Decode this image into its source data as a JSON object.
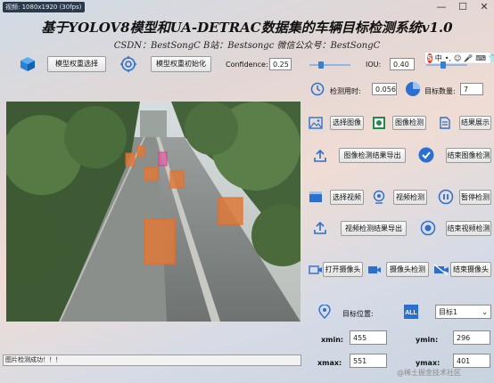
{
  "window": {
    "title": "视频: 1080x1920 (30fps)",
    "minimize": "—",
    "maximize": "☐",
    "close": "✕"
  },
  "header": {
    "title": "基于YOLOV8模型和UA-DETRAC数据集的车辆目标检测系统v1.0",
    "subtitle": "CSDN：BestSongC   B站：Bestsongc   微信公众号：BestSongC"
  },
  "ime": {
    "logo": "S",
    "lang": "中",
    "items": [
      "•,",
      "☺",
      "🎤",
      "⌨",
      "👕",
      "▦"
    ]
  },
  "toolbar": {
    "model_select": "模型权重选择",
    "model_init": "模型权重初始化",
    "confidence_label": "Confidence:",
    "confidence_value": "0.25",
    "iou_label": "IOU:",
    "iou_value": "0.40"
  },
  "sliders": {
    "confidence_fraction": 0.25,
    "iou_fraction": 0.4
  },
  "stats": {
    "time_label": "检测用时:",
    "time_value": "0.056",
    "count_label": "目标数量:",
    "count_value": "7"
  },
  "image_section": {
    "select": "选择图像",
    "detect": "图像检测",
    "show": "结果展示",
    "export": "图像检测结果导出",
    "stop": "结束图像检测"
  },
  "video_section": {
    "select": "选择视频",
    "detect": "视频检测",
    "pause": "暂停检测",
    "export": "视频检测结果导出",
    "stop": "结束视频检测"
  },
  "camera_section": {
    "open": "打开摄像头",
    "detect": "摄像头检测",
    "stop": "结束摄像头"
  },
  "target": {
    "label": "目标位置:",
    "select_value": "目标1",
    "xmin_label": "xmin:",
    "xmin": "455",
    "ymin_label": "ymin:",
    "ymin": "296",
    "xmax_label": "xmax:",
    "xmax": "551",
    "ymax_label": "ymax:",
    "ymax": "401"
  },
  "status": {
    "text": "图片检测成功！！！"
  },
  "watermark": "@稀土掘金技术社区",
  "colors": {
    "box": "#ef6a22",
    "box_alt": "#e0308a",
    "accent": "#2b6fd0"
  }
}
